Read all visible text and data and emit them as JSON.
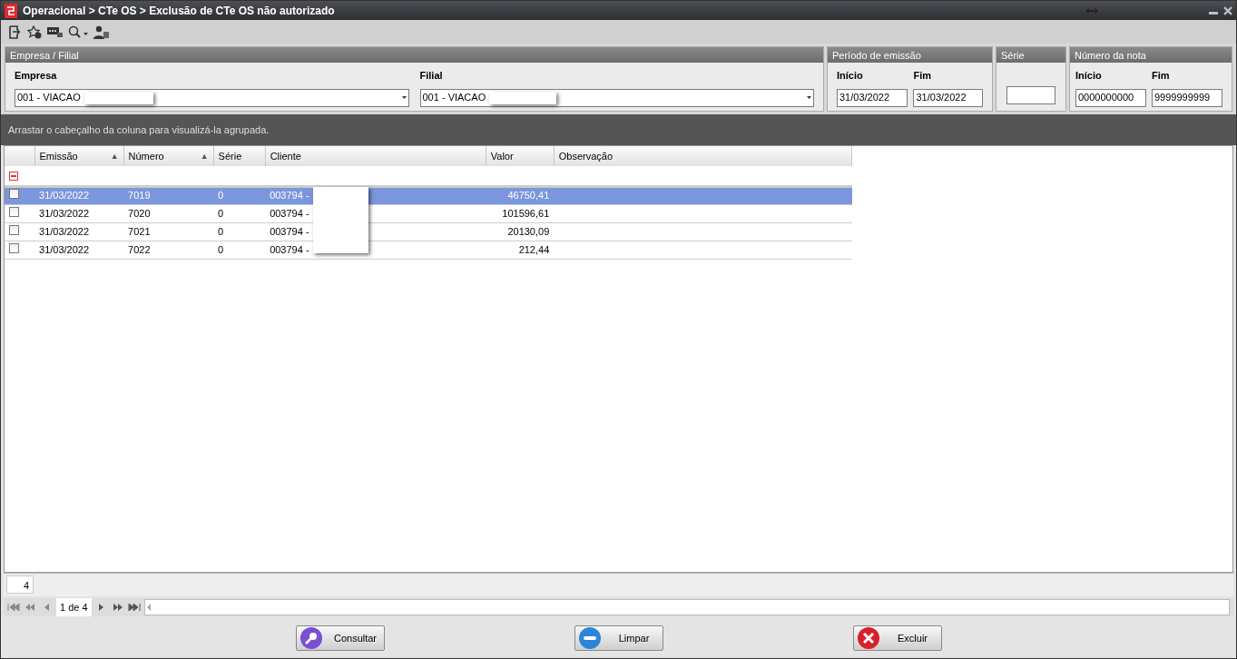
{
  "window": {
    "title": "Operacional > CTe OS > Exclusão de CTe OS não autorizado"
  },
  "filters": {
    "empresa_filial": {
      "title": "Empresa / Filial",
      "empresa": {
        "label": "Empresa",
        "value": "001 - VIACAO"
      },
      "filial": {
        "label": "Filial",
        "value": "001 - VIACAO"
      }
    },
    "periodo": {
      "title": "Período de emissão",
      "inicio": {
        "label": "Início",
        "value": "31/03/2022"
      },
      "fim": {
        "label": "Fim",
        "value": "31/03/2022"
      }
    },
    "serie": {
      "title": "Série"
    },
    "numero": {
      "title": "Número da nota",
      "inicio": {
        "label": "Início",
        "value": "0000000000"
      },
      "fim": {
        "label": "Fim",
        "value": "9999999999"
      }
    }
  },
  "grid": {
    "group_hint": "Arrastar o cabeçalho da coluna para visualizá-la agrupada.",
    "columns": [
      {
        "label": "Emissão",
        "sort_arrow": "▲"
      },
      {
        "label": "Número",
        "sort_arrow": "▲"
      },
      {
        "label": "Série"
      },
      {
        "label": "Cliente"
      },
      {
        "label": "Valor"
      },
      {
        "label": "Observação"
      }
    ],
    "rows": [
      {
        "selected": true,
        "checked": false,
        "cells": [
          "31/03/2022",
          "7019",
          "0",
          "003794 -",
          "46750,41",
          ""
        ]
      },
      {
        "selected": false,
        "checked": false,
        "cells": [
          "31/03/2022",
          "7020",
          "0",
          "003794 -",
          "101596,61",
          ""
        ]
      },
      {
        "selected": false,
        "checked": false,
        "cells": [
          "31/03/2022",
          "7021",
          "0",
          "003794 -",
          "20130,09",
          ""
        ]
      },
      {
        "selected": false,
        "checked": false,
        "cells": [
          "31/03/2022",
          "7022",
          "0",
          "003794 -",
          "212,44",
          ""
        ]
      }
    ],
    "footer_count": "4",
    "pager": "1 de 4"
  },
  "buttons": [
    {
      "kind": "search",
      "label": "Consultar"
    },
    {
      "kind": "clear",
      "label": "Limpar"
    },
    {
      "kind": "delete",
      "label": "Excluir"
    }
  ]
}
